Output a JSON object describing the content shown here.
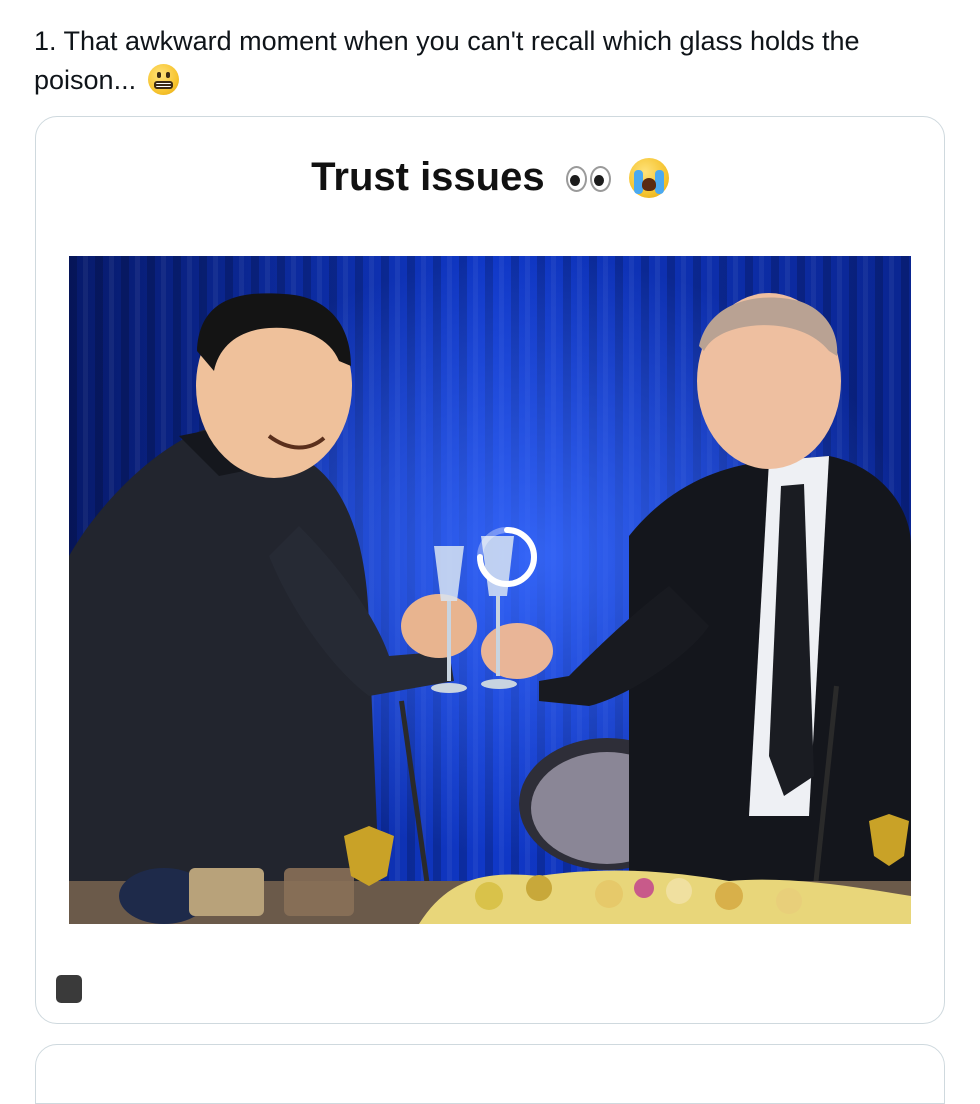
{
  "post": {
    "text": "1. That awkward moment when you can't recall which glass holds the poison...",
    "emoji": "grimacing-face"
  },
  "video_card": {
    "caption": "Trust issues",
    "caption_emojis": [
      "eyes",
      "loudly-crying-face"
    ],
    "state": "loading"
  },
  "colors": {
    "border": "#cfd9de",
    "curtain": "#0a2aa8",
    "text": "#0f1419"
  }
}
